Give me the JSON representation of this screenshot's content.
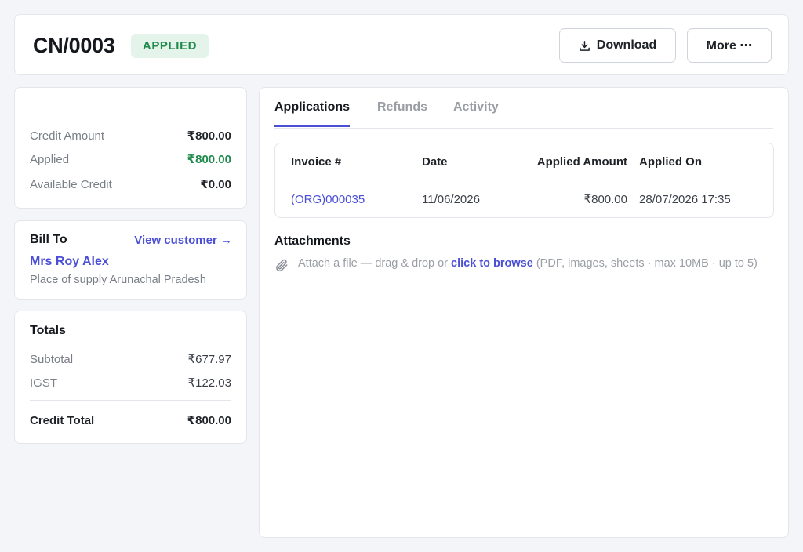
{
  "header": {
    "title": "CN/0003",
    "status": "APPLIED",
    "download_label": "Download",
    "more_label": "More ⋯"
  },
  "summary": {
    "credit_amount_label": "Credit Amount",
    "credit_amount_value": "₹800.00",
    "applied_label": "Applied",
    "applied_value": "₹800.00",
    "available_label": "Available Credit",
    "available_value": "₹0.00"
  },
  "bill_to": {
    "heading": "Bill To",
    "view_customer": "View customer →",
    "customer_name": "Mrs Roy Alex",
    "place_of_supply": "Place of supply  Arunachal Pradesh"
  },
  "totals": {
    "heading": "Totals",
    "subtotal_label": "Subtotal",
    "subtotal_value": "₹677.97",
    "igst_label": "IGST",
    "igst_value": "₹122.03",
    "credit_total_label": "Credit Total",
    "credit_total_value": "₹800.00"
  },
  "tabs": [
    {
      "label": "Applications",
      "active": true
    },
    {
      "label": "Refunds",
      "active": false
    },
    {
      "label": "Activity",
      "active": false
    }
  ],
  "applications_table": {
    "columns": [
      "Invoice #",
      "Date",
      "Applied Amount",
      "Applied On"
    ],
    "rows": [
      {
        "invoice": "(ORG)000035",
        "date": "11/06/2026",
        "amount": "₹800.00",
        "applied_on": "28/07/2026 17:35"
      }
    ]
  },
  "attachments": {
    "heading": "Attachments",
    "hint_prefix": "Attach a file — drag & drop or ",
    "browse_label": "click to browse",
    "hint_suffix": " (PDF, images, sheets · max 10MB · up to 5)"
  },
  "colors": {
    "accent": "#4b4fd6",
    "success": "#1f8a4c",
    "badge_bg": "#e4f4ea"
  },
  "icons": {
    "download": "download-icon",
    "attach": "paperclip-icon"
  }
}
